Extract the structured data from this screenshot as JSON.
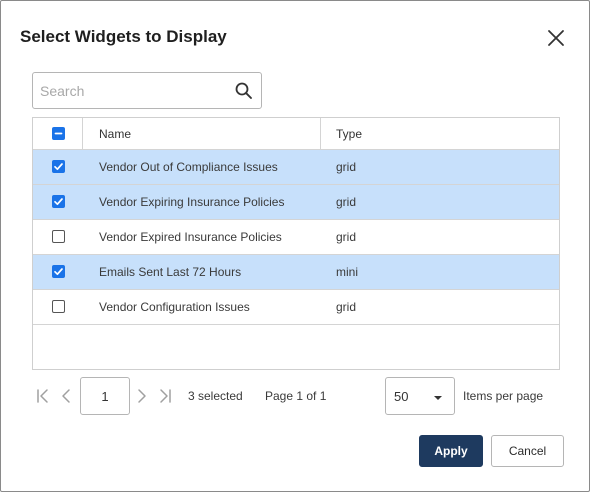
{
  "dialog": {
    "title": "Select Widgets to Display"
  },
  "search": {
    "placeholder": "Search",
    "value": ""
  },
  "grid": {
    "columns": [
      {
        "label": "Name"
      },
      {
        "label": "Type"
      }
    ],
    "header_checkbox_state": "indeterminate",
    "rows": [
      {
        "name": "Vendor Out of Compliance Issues",
        "type": "grid",
        "checked": true
      },
      {
        "name": "Vendor Expiring Insurance Policies",
        "type": "grid",
        "checked": true
      },
      {
        "name": "Vendor Expired Insurance Policies",
        "type": "grid",
        "checked": false
      },
      {
        "name": "Emails Sent Last 72 Hours",
        "type": "mini",
        "checked": true
      },
      {
        "name": "Vendor Configuration Issues",
        "type": "grid",
        "checked": false
      }
    ]
  },
  "pager": {
    "current_page": "1",
    "selected_text": "3 selected",
    "page_info": "Page 1 of 1",
    "page_size": "50",
    "items_per_page_label": "Items per page"
  },
  "buttons": {
    "apply": "Apply",
    "cancel": "Cancel"
  },
  "icons": {
    "close": "close-icon",
    "search": "search-icon",
    "first": "first-page-icon",
    "prev": "previous-page-icon",
    "next": "next-page-icon",
    "last": "last-page-icon",
    "dropdown": "chevron-down-icon"
  },
  "colors": {
    "selected_row": "#c7e0fb",
    "checkbox_accent": "#1a73e8",
    "primary_button": "#1e3a5f"
  }
}
